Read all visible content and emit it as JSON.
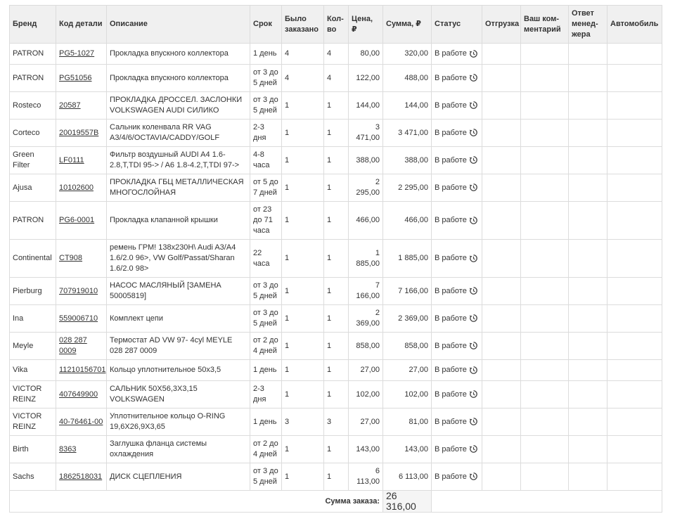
{
  "columns": [
    "Бренд",
    "Код детали",
    "Описание",
    "Срок",
    "Было заказано",
    "Кол-во",
    "Цена, ₽",
    "Сумма, ₽",
    "Статус",
    "Отгрузка",
    "Ваш ком-ментарий",
    "Ответ менед-жера",
    "Автомобиль"
  ],
  "rows": [
    {
      "brand": "PATRON",
      "code": "PG5-1027",
      "desc": "Прокладка впускного коллектора",
      "term": "1 день",
      "ordered": "4",
      "qty": "4",
      "price": "80,00",
      "sum": "320,00",
      "status": "В работе"
    },
    {
      "brand": "PATRON",
      "code": "PG51056",
      "desc": "Прокладка впускного коллектора",
      "term": "от 3 до 5 дней",
      "ordered": "4",
      "qty": "4",
      "price": "122,00",
      "sum": "488,00",
      "status": "В работе"
    },
    {
      "brand": "Rosteco",
      "code": "20587",
      "desc": "ПРОКЛАДКА ДРОССЕЛ. ЗАСЛОНКИ VOLKSWAGEN AUDI СИЛИКО",
      "term": "от 3 до 5 дней",
      "ordered": "1",
      "qty": "1",
      "price": "144,00",
      "sum": "144,00",
      "status": "В работе"
    },
    {
      "brand": "Corteco",
      "code": "20019557B",
      "desc": "Сальник коленвала RR VAG A3/4/6/OCTAVIA/CADDY/GOLF",
      "term": "2-3 дня",
      "ordered": "1",
      "qty": "1",
      "price": "3 471,00",
      "sum": "3 471,00",
      "status": "В работе"
    },
    {
      "brand": "Green Filter",
      "code": "LF0111",
      "desc": "Фильтр воздушный AUDI A4 1.6-2.8,T,TDI 95-> / A6 1.8-4.2,T,TDI 97->",
      "term": "4-8 часа",
      "ordered": "1",
      "qty": "1",
      "price": "388,00",
      "sum": "388,00",
      "status": "В работе"
    },
    {
      "brand": "Ajusa",
      "code": "10102600",
      "desc": "ПРОКЛАДКА ГБЦ МЕТАЛЛИЧЕСКАЯ МНОГОСЛОЙНАЯ",
      "term": "от 5 до 7 дней",
      "ordered": "1",
      "qty": "1",
      "price": "2 295,00",
      "sum": "2 295,00",
      "status": "В работе"
    },
    {
      "brand": "PATRON",
      "code": "PG6-0001",
      "desc": "Прокладка клапанной крышки",
      "term": "от 23 до 71 часа",
      "ordered": "1",
      "qty": "1",
      "price": "466,00",
      "sum": "466,00",
      "status": "В работе"
    },
    {
      "brand": "Continental",
      "code": "CT908",
      "desc": "ремень ГРМ! 138x230H\\ Audi A3/A4 1.6/2.0 96>, VW Golf/Passat/Sharan 1.6/2.0 98>",
      "term": "22 часа",
      "ordered": "1",
      "qty": "1",
      "price": "1 885,00",
      "sum": "1 885,00",
      "status": "В работе"
    },
    {
      "brand": "Pierburg",
      "code": "707919010",
      "desc": "НАСОС МАСЛЯНЫЙ [ЗАМЕНА 50005819]",
      "term": "от 3 до 5 дней",
      "ordered": "1",
      "qty": "1",
      "price": "7 166,00",
      "sum": "7 166,00",
      "status": "В работе"
    },
    {
      "brand": "Ina",
      "code": "559006710",
      "desc": "Комплект цепи",
      "term": "от 3 до 5 дней",
      "ordered": "1",
      "qty": "1",
      "price": "2 369,00",
      "sum": "2 369,00",
      "status": "В работе"
    },
    {
      "brand": "Meyle",
      "code": "028 287 0009",
      "desc": "Термостат AD VW 97- 4cyl MEYLE 028 287 0009",
      "term": "от 2 до 4 дней",
      "ordered": "1",
      "qty": "1",
      "price": "858,00",
      "sum": "858,00",
      "status": "В работе"
    },
    {
      "brand": "Vika",
      "code": "11210156701",
      "desc": "Кольцо уплотнительное 50x3,5",
      "term": "1 день",
      "ordered": "1",
      "qty": "1",
      "price": "27,00",
      "sum": "27,00",
      "status": "В работе"
    },
    {
      "brand": "VICTOR REINZ",
      "code": "407649900",
      "desc": "САЛЬНИК 50X56,3X3,15 VOLKSWAGEN",
      "term": "2-3 дня",
      "ordered": "1",
      "qty": "1",
      "price": "102,00",
      "sum": "102,00",
      "status": "В работе"
    },
    {
      "brand": "VICTOR REINZ",
      "code": "40-76461-00",
      "desc": "Уплотнительное кольцо O-RING 19,6X26,9X3,65",
      "term": "1 день",
      "ordered": "3",
      "qty": "3",
      "price": "27,00",
      "sum": "81,00",
      "status": "В работе"
    },
    {
      "brand": "Birth",
      "code": "8363",
      "desc": "Заглушка фланца системы охлаждения",
      "term": "от 2 до 4 дней",
      "ordered": "1",
      "qty": "1",
      "price": "143,00",
      "sum": "143,00",
      "status": "В работе"
    },
    {
      "brand": "Sachs",
      "code": "1862518031",
      "desc": "ДИСК СЦЕПЛЕНИЯ",
      "term": "от 3 до 5 дней",
      "ordered": "1",
      "qty": "1",
      "price": "6 113,00",
      "sum": "6 113,00",
      "status": "В работе"
    }
  ],
  "total": {
    "label": "Сумма заказа:",
    "value": "26 316,00"
  },
  "icons": {
    "status_history": "history-icon"
  }
}
